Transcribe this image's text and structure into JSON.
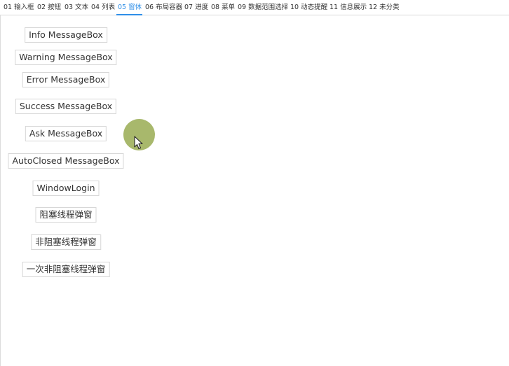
{
  "tabs": [
    {
      "label": "01 输入框",
      "active": false
    },
    {
      "label": "02 按钮",
      "active": false
    },
    {
      "label": "03 文本",
      "active": false
    },
    {
      "label": "04 列表",
      "active": false
    },
    {
      "label": "05 窗体",
      "active": true
    },
    {
      "label": "06 布局容器",
      "active": false
    },
    {
      "label": "07 进度",
      "active": false
    },
    {
      "label": "08 菜单",
      "active": false
    },
    {
      "label": "09 数据范围选择",
      "active": false
    },
    {
      "label": "10 动态提醒",
      "active": false
    },
    {
      "label": "11 信息展示",
      "active": false
    },
    {
      "label": "12 未分类",
      "active": false
    }
  ],
  "buttons": [
    {
      "label": "Info MessageBox"
    },
    {
      "label": "Warning MessageBox"
    },
    {
      "label": "Error MessageBox"
    },
    {
      "label": "Success MessageBox"
    },
    {
      "label": "Ask MessageBox"
    },
    {
      "label": "AutoClosed MessageBox"
    },
    {
      "label": "WindowLogin"
    },
    {
      "label": "阻塞线程弹窗"
    },
    {
      "label": "非阻塞线程弹窗"
    },
    {
      "label": "一次非阻塞线程弹窗"
    }
  ],
  "colors": {
    "accent": "#2f8fe8",
    "cursor_highlight": "#9fb05c"
  },
  "icons": {
    "cursor": "mouse-pointer-icon"
  }
}
